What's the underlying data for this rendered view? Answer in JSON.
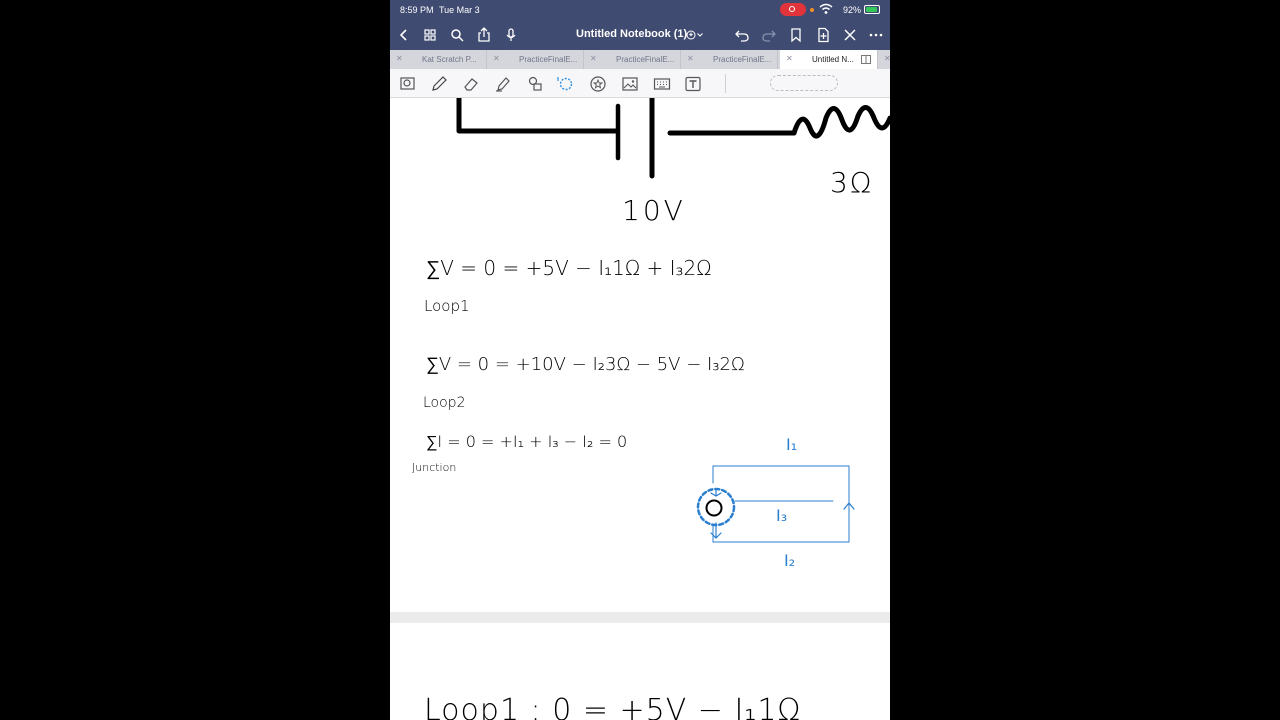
{
  "status_bar": {
    "time": "8:59 PM",
    "date": "Tue Mar 3",
    "battery": "92%",
    "battery_level": 0.92
  },
  "nav_bar": {
    "title": "Untitled Notebook (1)",
    "icons": [
      "back-chevron-icon",
      "grid-icon",
      "search-icon",
      "share-icon",
      "microphone-icon",
      "undo-icon",
      "redo-icon",
      "bookmark-icon",
      "add-page-icon",
      "close-icon",
      "more-icon"
    ]
  },
  "tabs": [
    {
      "label": "Kat Scratch P...",
      "active": false
    },
    {
      "label": "PracticeFinalE...",
      "active": false
    },
    {
      "label": "PracticeFinalE...",
      "active": false
    },
    {
      "label": "PracticeFinalE...",
      "active": false
    },
    {
      "label": "Untitled N...",
      "active": true
    }
  ],
  "toolbar": {
    "tools": [
      "zoom-icon",
      "pen-icon",
      "eraser-icon",
      "highlighter-icon",
      "shapes-icon",
      "lasso-icon",
      "sticker-icon",
      "image-icon",
      "keyboard-icon",
      "text-icon"
    ]
  },
  "notes": {
    "voltage_label": "10V",
    "resistor_label": "3Ω",
    "eq1": "∑V = 0 = +5V − I₁1Ω + I₃2Ω",
    "eq1_sub": "Loop1",
    "eq2": "∑V = 0 = +10V − I₂3Ω − 5V − I₃2Ω",
    "eq2_sub": "Loop2",
    "eq3": "∑I = 0 = +I₁ + I₃ − I₂ = 0",
    "eq3_sub": "Junction",
    "diagram_i1": "I₁",
    "diagram_i3": "I₃",
    "diagram_i2": "I₂",
    "page2_eq": "Loop1 :   0 = +5V − I₁1Ω"
  },
  "colors": {
    "nav_bg": "#3f4b70",
    "ink": "#000000",
    "diagram_ink": "#2a7fcf",
    "record": "#e0343a",
    "battery": "#34c759"
  }
}
